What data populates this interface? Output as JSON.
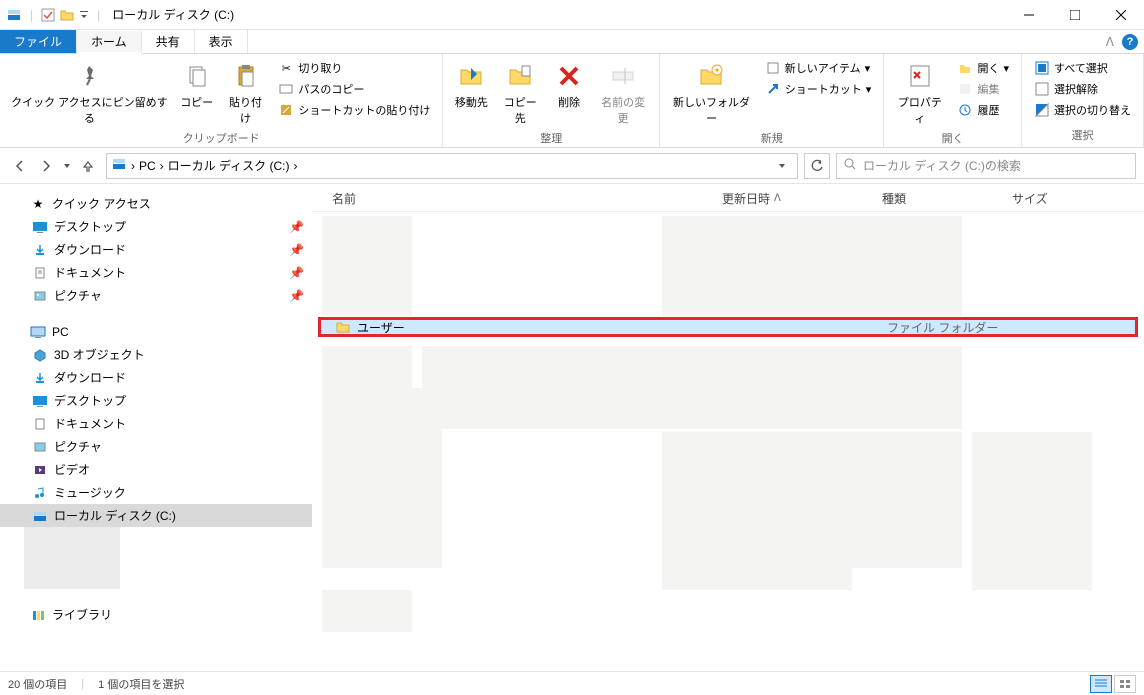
{
  "window": {
    "title": "ローカル ディスク (C:)"
  },
  "tabs": {
    "file": "ファイル",
    "home": "ホーム",
    "share": "共有",
    "view": "表示"
  },
  "ribbon": {
    "clipboard": {
      "pin": "クイック アクセスにピン留めする",
      "copy": "コピー",
      "paste": "貼り付け",
      "cut": "切り取り",
      "copy_path": "パスのコピー",
      "paste_shortcut": "ショートカットの貼り付け",
      "label": "クリップボード"
    },
    "organize": {
      "move_to": "移動先",
      "copy_to": "コピー先",
      "delete": "削除",
      "rename": "名前の変更",
      "label": "整理"
    },
    "new": {
      "new_folder": "新しいフォルダー",
      "new_item": "新しいアイテム",
      "shortcut": "ショートカット",
      "label": "新規"
    },
    "open": {
      "properties": "プロパティ",
      "open": "開く",
      "edit": "編集",
      "history": "履歴",
      "label": "開く"
    },
    "select": {
      "select_all": "すべて選択",
      "select_none": "選択解除",
      "invert": "選択の切り替え",
      "label": "選択"
    }
  },
  "breadcrumb": {
    "pc": "PC",
    "c": "ローカル ディスク (C:)"
  },
  "search": {
    "placeholder": "ローカル ディスク (C:)の検索"
  },
  "tree": {
    "quick_access": "クイック アクセス",
    "desktop": "デスクトップ",
    "downloads": "ダウンロード",
    "documents": "ドキュメント",
    "pictures": "ピクチャ",
    "pc": "PC",
    "objects_3d": "3D オブジェクト",
    "videos": "ビデオ",
    "music": "ミュージック",
    "c_drive": "ローカル ディスク (C:)",
    "library": "ライブラリ"
  },
  "columns": {
    "name": "名前",
    "date": "更新日時",
    "type": "種類",
    "size": "サイズ"
  },
  "file": {
    "name": "ユーザー",
    "type": "ファイル フォルダー"
  },
  "status": {
    "items": "20 個の項目",
    "selected": "1 個の項目を選択"
  }
}
